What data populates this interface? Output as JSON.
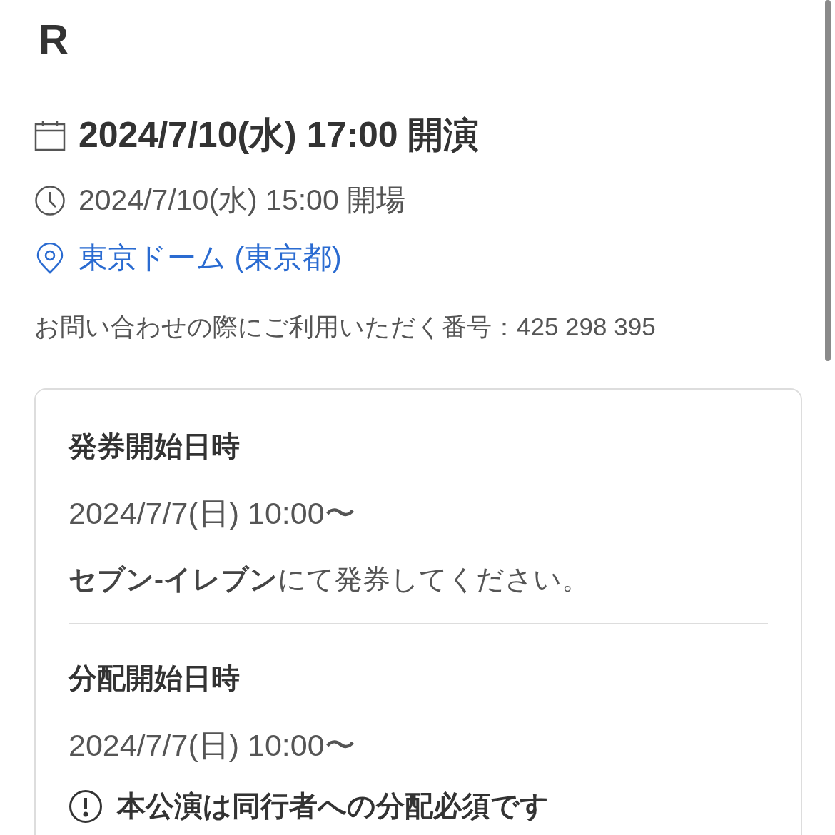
{
  "title": "R",
  "performance": {
    "start": "2024/7/10(水) 17:00 開演",
    "doors": "2024/7/10(水) 15:00 開場",
    "venue": "東京ドーム (東京都)"
  },
  "inquiry": "お問い合わせの際にご利用いただく番号：425 298 395",
  "card": {
    "sections": [
      {
        "heading": "発券開始日時",
        "datetime": "2024/7/7(日) 10:00〜",
        "note": "**セブン-イレブン**にて発券してください。"
      },
      {
        "heading": "分配開始日時",
        "datetime": "2024/7/7(日) 10:00〜",
        "notice": "本公演は同行者への分配必須です"
      }
    ]
  }
}
